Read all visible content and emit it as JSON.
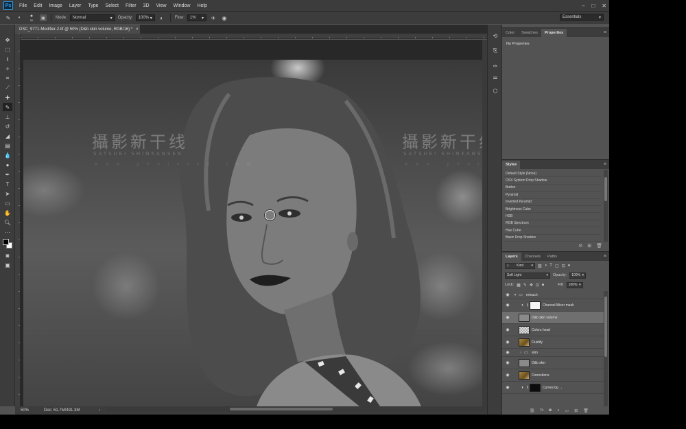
{
  "menu": {
    "logo": "Ps",
    "items": [
      "File",
      "Edit",
      "Image",
      "Layer",
      "Type",
      "Select",
      "Filter",
      "3D",
      "View",
      "Window",
      "Help"
    ],
    "window_controls": [
      "–",
      "□",
      "✕"
    ]
  },
  "options": {
    "brush_size": "50",
    "mode_label": "Mode:",
    "mode_value": "Normal",
    "opacity_label": "Opacity:",
    "opacity_value": "100%",
    "flow_label": "Flow:",
    "flow_value": "1%",
    "workspace": "Essentials"
  },
  "document": {
    "tab_title": "DSC_9771-Modifier-2.tif @ 50% (D&b skin volume, RGB/16) *",
    "close": "×"
  },
  "watermark": {
    "line1": "攝影新干线",
    "line2": "SATSUEI SHINKANSEN",
    "line3": "w w w . p h o t o s k s . c o m"
  },
  "status": {
    "zoom": "50%",
    "doc_size": "Doc: 61.7M/491.3M",
    "arrow": "›"
  },
  "properties": {
    "tabs": [
      "Color",
      "Swatches",
      "Properties"
    ],
    "active_tab": "Properties",
    "empty_text": "No Properties"
  },
  "styles": {
    "title": "Styles",
    "items": [
      "Default Style (None)",
      "OSX System Drop Shadow",
      "Button",
      "Pyramid",
      "Inverted Pyramid",
      "Brightness Cube",
      "HSB",
      "RGB Spectrum",
      "Hue Cube",
      "Basic Drop Shadow"
    ]
  },
  "layers_panel": {
    "tabs": [
      "Layers",
      "Channels",
      "Paths"
    ],
    "filter_kind": "Kind",
    "blend_mode": "Soft Light",
    "opacity_label": "Opacity:",
    "opacity_value": "100%",
    "lock_label": "Lock:",
    "fill_label": "Fill:",
    "fill_value": "100%",
    "layers": [
      {
        "name": "retouch",
        "type": "group"
      },
      {
        "name": "Channel Mixer mask",
        "type": "adjustment"
      },
      {
        "name": "D&b skin volume",
        "type": "gray",
        "selected": true
      },
      {
        "name": "Colors head",
        "type": "transparent"
      },
      {
        "name": "Fluidify",
        "type": "photo"
      },
      {
        "name": "skin",
        "type": "group"
      },
      {
        "name": "D&b skin",
        "type": "gray"
      },
      {
        "name": "Corrections",
        "type": "photo"
      },
      {
        "name": "Curves bg →",
        "type": "curves"
      }
    ]
  }
}
